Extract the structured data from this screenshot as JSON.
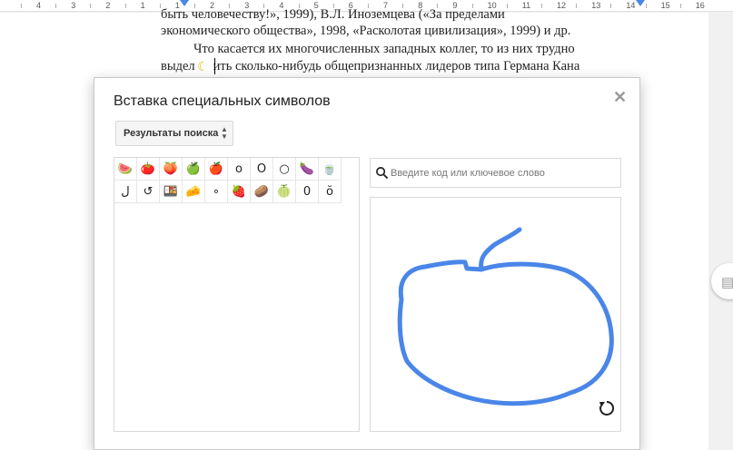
{
  "ruler": {
    "numbers": [
      "4",
      "3",
      "2",
      "1",
      "1",
      "2",
      "3",
      "4",
      "5",
      "6",
      "7",
      "8",
      "9",
      "10",
      "11",
      "12",
      "13",
      "14",
      "15",
      "16"
    ]
  },
  "document": {
    "line1": "быть человечеству!», 1999), В.Л. Иноземцева («За пределами",
    "line2": "экономического общества», 1998, «Расколотая цивилизация», 1999) и др.",
    "line3": "Что касается их многочисленных западных коллег, то из них трудно",
    "line4_before": "выдел",
    "line4_after": "ить сколько-нибудь общепризнанных лидеров типа Германа Кана"
  },
  "dialog": {
    "title": "Вставка специальных символов",
    "close_icon": "close-icon",
    "category_dropdown": "Результаты поиска",
    "search_placeholder": "Введите код или ключевое слово",
    "symbols": [
      "🍉",
      "🍅",
      "🍑",
      "🍏",
      "🍎",
      "o",
      "O",
      "○",
      "🍆",
      "🍵",
      "ل",
      "↺",
      "🍱",
      "🧀",
      "∘",
      "🍓",
      "🥔",
      "🍈",
      "0",
      "ŏ"
    ],
    "undo_icon": "undo-icon"
  }
}
